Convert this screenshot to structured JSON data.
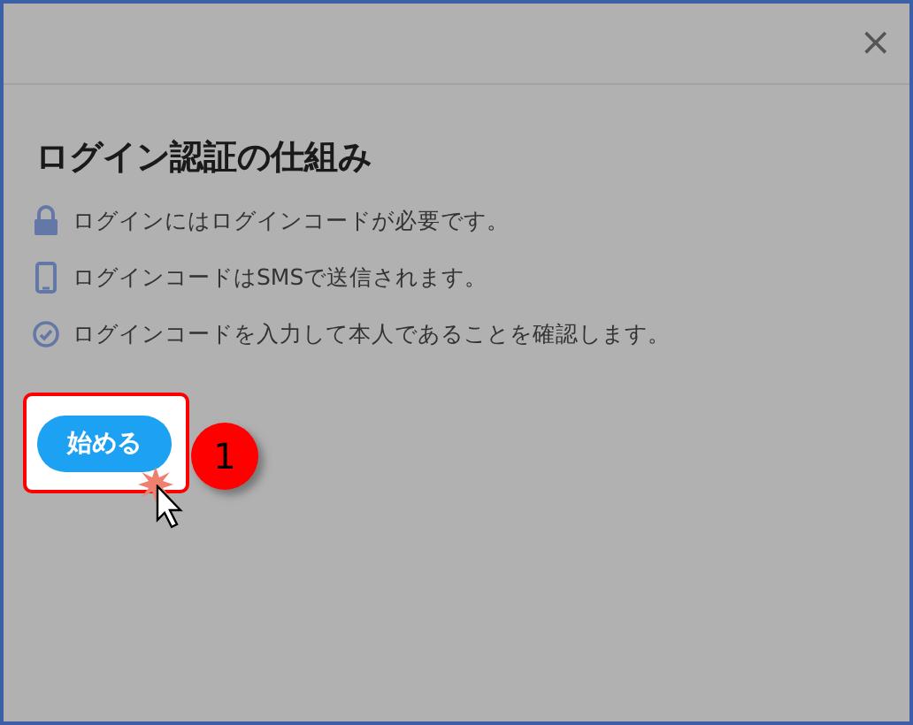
{
  "dialog": {
    "close": "×",
    "title": "ログイン認証の仕組み",
    "items": [
      {
        "kind": "lock",
        "text": "ログインにはログインコードが必要です。"
      },
      {
        "kind": "phone",
        "text": "ログインコードはSMSで送信されます。"
      },
      {
        "kind": "check",
        "text": "ログインコードを入力して本人であることを確認します。"
      }
    ],
    "start_button": "始める"
  },
  "annotation": {
    "step": "1"
  }
}
